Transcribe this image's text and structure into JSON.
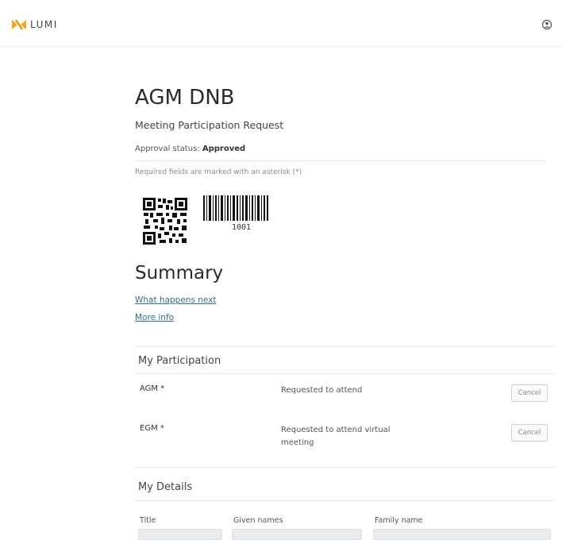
{
  "brand": {
    "name": "LUMI",
    "accent": "#f2a623"
  },
  "header": {
    "user_icon": "user-circle-icon"
  },
  "meeting": {
    "title": "AGM DNB",
    "subtitle": "Meeting Participation Request",
    "approval_label": "Approval status:",
    "approval_value": "Approved",
    "required_note": "Required fields are marked with an asterisk (*)",
    "barcode_number": "1001"
  },
  "summary": {
    "title": "Summary",
    "links": [
      "What happens next",
      "More info"
    ]
  },
  "participation": {
    "title": "My Participation",
    "rows": [
      {
        "name": "AGM *",
        "status": "Requested to attend",
        "action": "Cancel"
      },
      {
        "name": "EGM *",
        "status": "Requested to attend virtual meeting",
        "action": "Cancel"
      }
    ]
  },
  "details": {
    "title": "My Details",
    "fields": [
      {
        "label": "Title",
        "value": ""
      },
      {
        "label": "Given names",
        "value": ""
      },
      {
        "label": "Family name",
        "value": ""
      }
    ]
  }
}
